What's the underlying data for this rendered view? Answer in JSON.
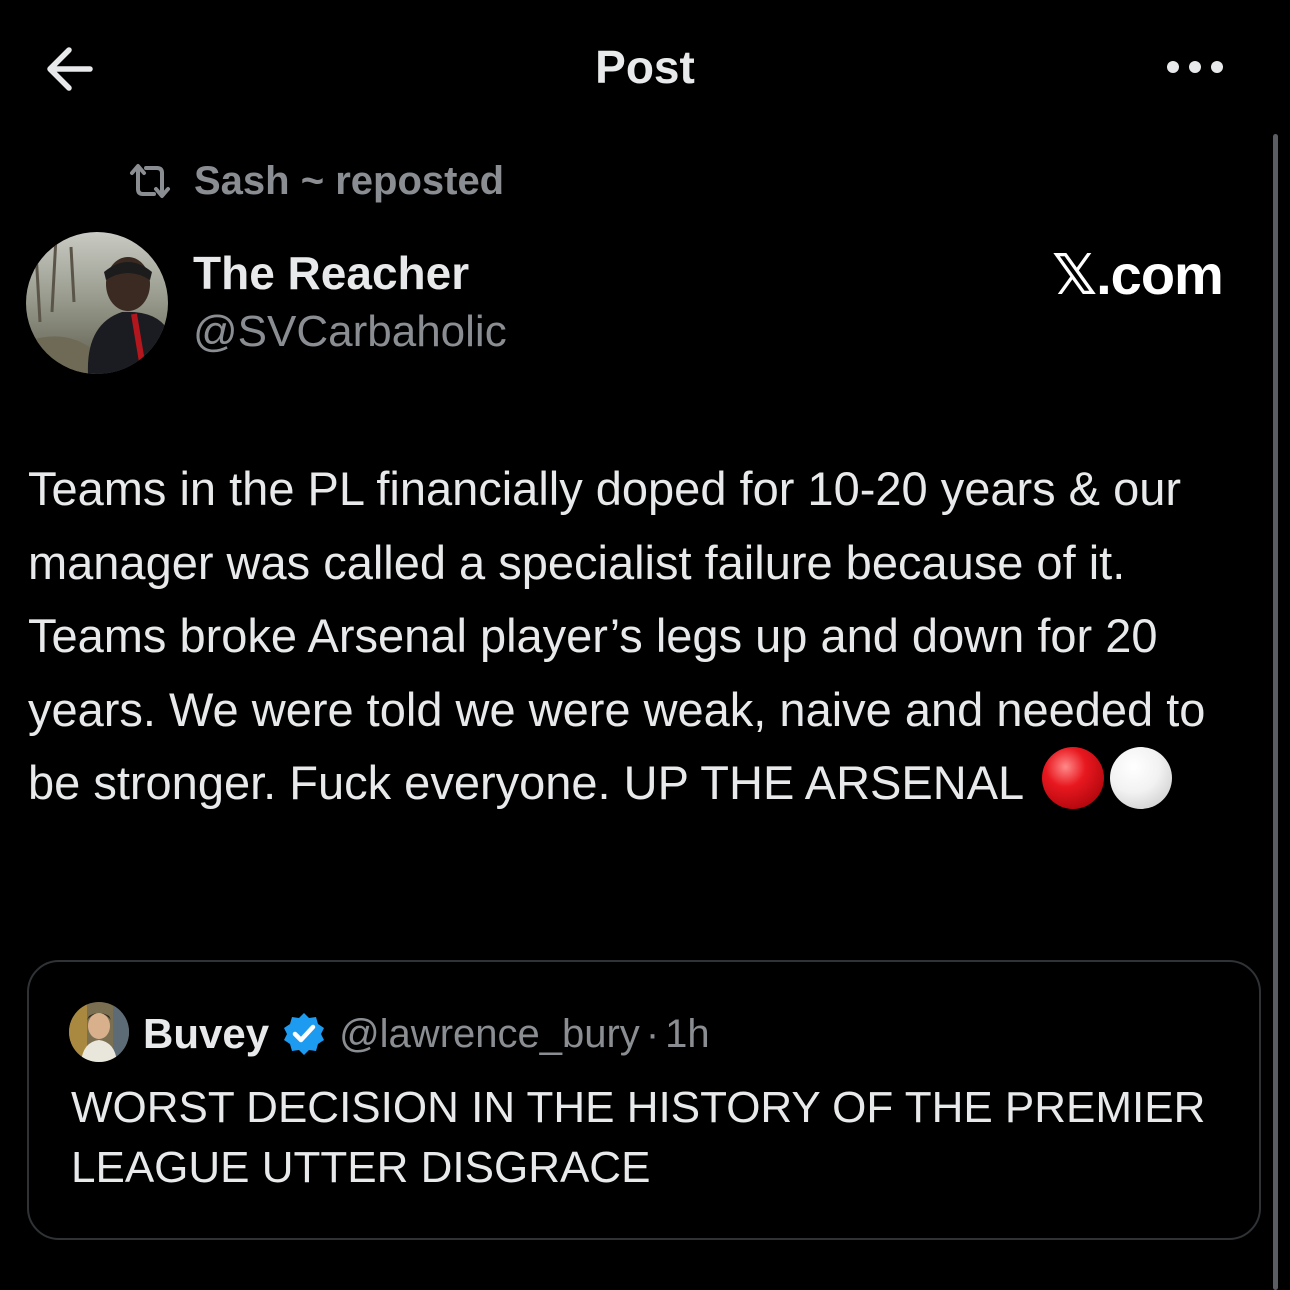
{
  "header": {
    "title": "Post",
    "back_icon": "arrow-left-icon",
    "more_icon": "more-horizontal-icon"
  },
  "repost": {
    "icon": "repost-icon",
    "text": "Sash ~ reposted"
  },
  "author": {
    "name": "The Reacher",
    "handle": "@SVCarbaholic",
    "avatar": "profile-photo"
  },
  "watermark": {
    "text": "𝕏.com"
  },
  "post": {
    "text": "Teams in the PL financially doped for 10-20 years & our manager was called a specialist failure because of it. Teams broke Arsenal player’s legs up and down for 20 years. We were told we were weak, naive and needed to be stronger. Fuck everyone. UP THE ARSENAL",
    "emojis": [
      "red-circle",
      "white-circle"
    ]
  },
  "quote": {
    "name": "Buvey",
    "verified": true,
    "handle": "@lawrence_bury",
    "separator": "·",
    "time": "1h",
    "text": "WORST DECISION IN THE HISTORY OF THE PREMIER LEAGUE UTTER DISGRACE"
  },
  "colors": {
    "background": "#000000",
    "primary_text": "#e7e9ea",
    "secondary_text": "#8a8d91",
    "border": "#2f3336",
    "verified_blue": "#1d9bf0"
  }
}
